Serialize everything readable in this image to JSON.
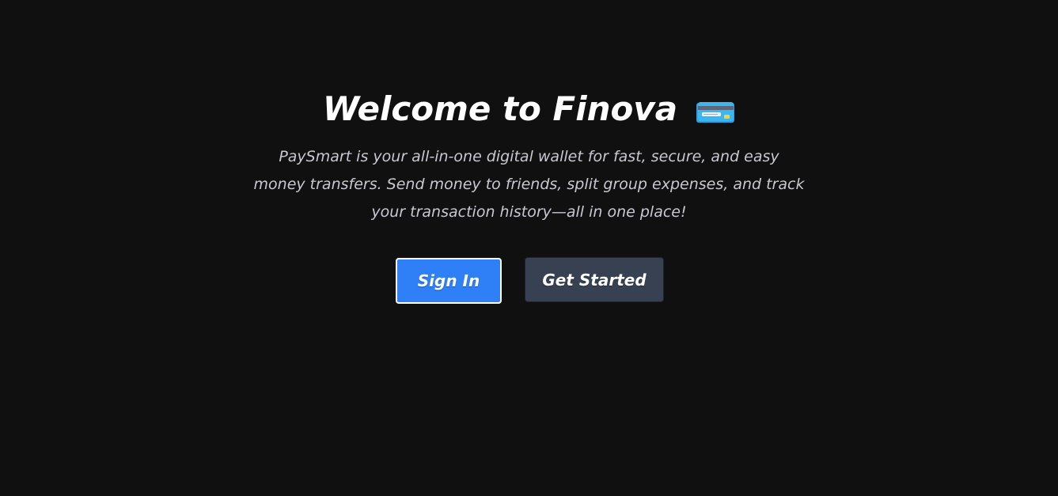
{
  "hero": {
    "title": "Welcome to Finova",
    "title_icon": "credit-card-icon",
    "description": "PaySmart is your all-in-one digital wallet for fast, secure, and easy money transfers. Send money to friends, split group expenses, and track your transaction history—all in one place!"
  },
  "actions": {
    "sign_in_label": "Sign In",
    "get_started_label": "Get Started"
  },
  "colors": {
    "background": "#101010",
    "primary": "#2f7ff7",
    "secondary": "#374152",
    "text": "#ffffff",
    "muted_text": "#c8c8d2"
  }
}
